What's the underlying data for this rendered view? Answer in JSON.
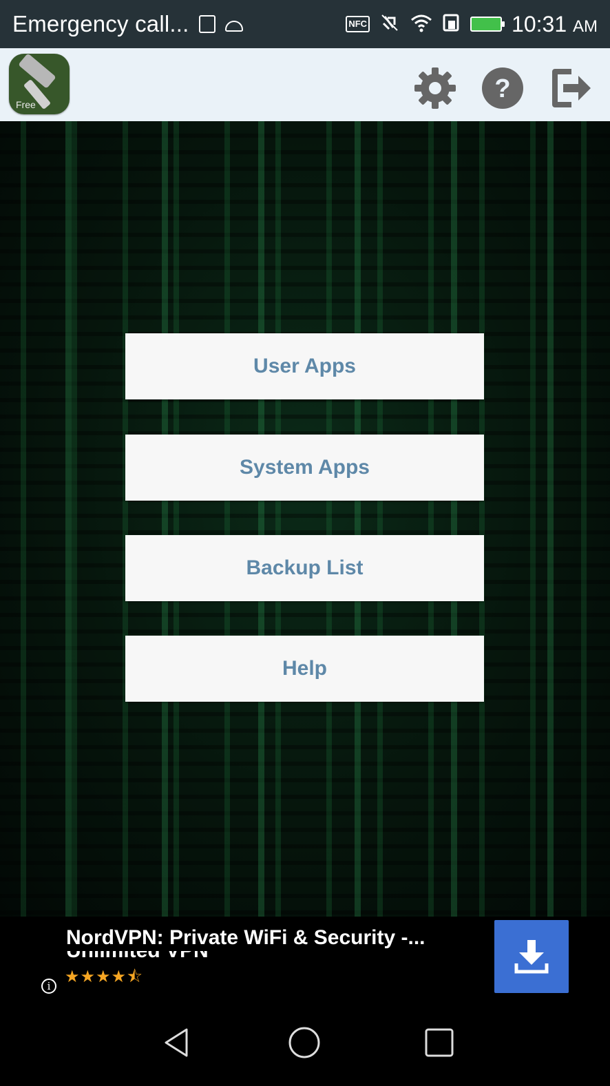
{
  "status_bar": {
    "carrier_text": "Emergency call...",
    "nfc_label": "NFC",
    "time": "10:31",
    "time_suffix": "AM",
    "icons": [
      "sim-info-icon",
      "android-icon",
      "nfc-icon",
      "vibrate-mute-icon",
      "wifi-icon",
      "sim-icon",
      "battery-charging-icon"
    ]
  },
  "app_bar": {
    "logo_badge": "Free",
    "actions": [
      "settings-gear-icon",
      "help-question-icon",
      "exit-icon"
    ]
  },
  "menu": {
    "user_apps": "User Apps",
    "system_apps": "System Apps",
    "backup_list": "Backup List",
    "help": "Help"
  },
  "ad": {
    "title": "NordVPN: Private WiFi & Security -...",
    "title_line2": "Unlimited VPN",
    "rating_stars": "★★★★⯪",
    "rating_value": 4.5,
    "info_glyph": "i",
    "action": "download-icon"
  },
  "nav": {
    "buttons": [
      "back-icon",
      "home-icon",
      "recent-apps-icon"
    ]
  },
  "colors": {
    "status_bar": "#263238",
    "app_bar": "#eaf2f8",
    "button_bg": "#f7f7f7",
    "button_text": "#5e88a8",
    "download_button": "#3b6fd3",
    "star_color": "#f6a623"
  }
}
